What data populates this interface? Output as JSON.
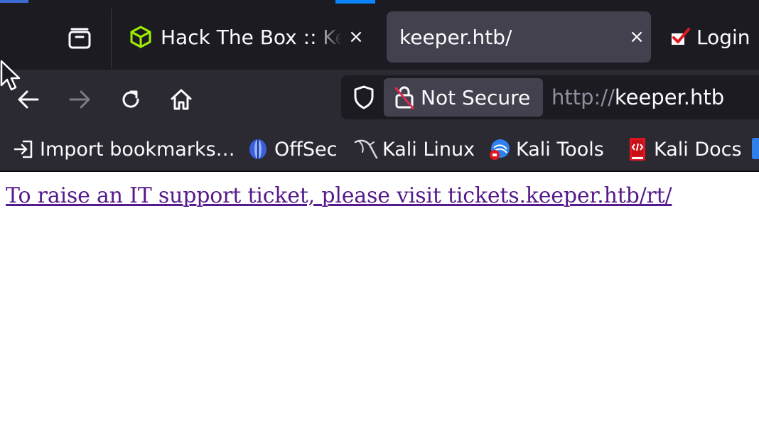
{
  "browser": {
    "tabs": [
      {
        "title": "Hack The Box :: Keeper",
        "favicon": "htb-cube-icon",
        "active": false
      },
      {
        "title": "keeper.htb/",
        "favicon": "",
        "active": true
      },
      {
        "title": "Login",
        "favicon": "rt-check-icon",
        "active": false
      }
    ],
    "close_glyph": "×",
    "security_label": "Not Secure",
    "url_scheme": "http://",
    "url_host": "keeper.htb",
    "bookmarks": [
      {
        "label": "Import bookmarks…",
        "icon": "import-icon"
      },
      {
        "label": "OffSec",
        "icon": "offsec-icon"
      },
      {
        "label": "Kali Linux",
        "icon": "kali-dragon-icon"
      },
      {
        "label": "Kali Tools",
        "icon": "kali-tools-icon"
      },
      {
        "label": "Kali Docs",
        "icon": "kali-docs-icon"
      }
    ]
  },
  "page": {
    "link_text": "To raise an IT support ticket, please visit tickets.keeper.htb/rt/"
  },
  "colors": {
    "chrome_dark": "#1c1b22",
    "toolbar": "#2b2a33",
    "active_tab": "#42414d",
    "link_visited": "#551a8b"
  }
}
